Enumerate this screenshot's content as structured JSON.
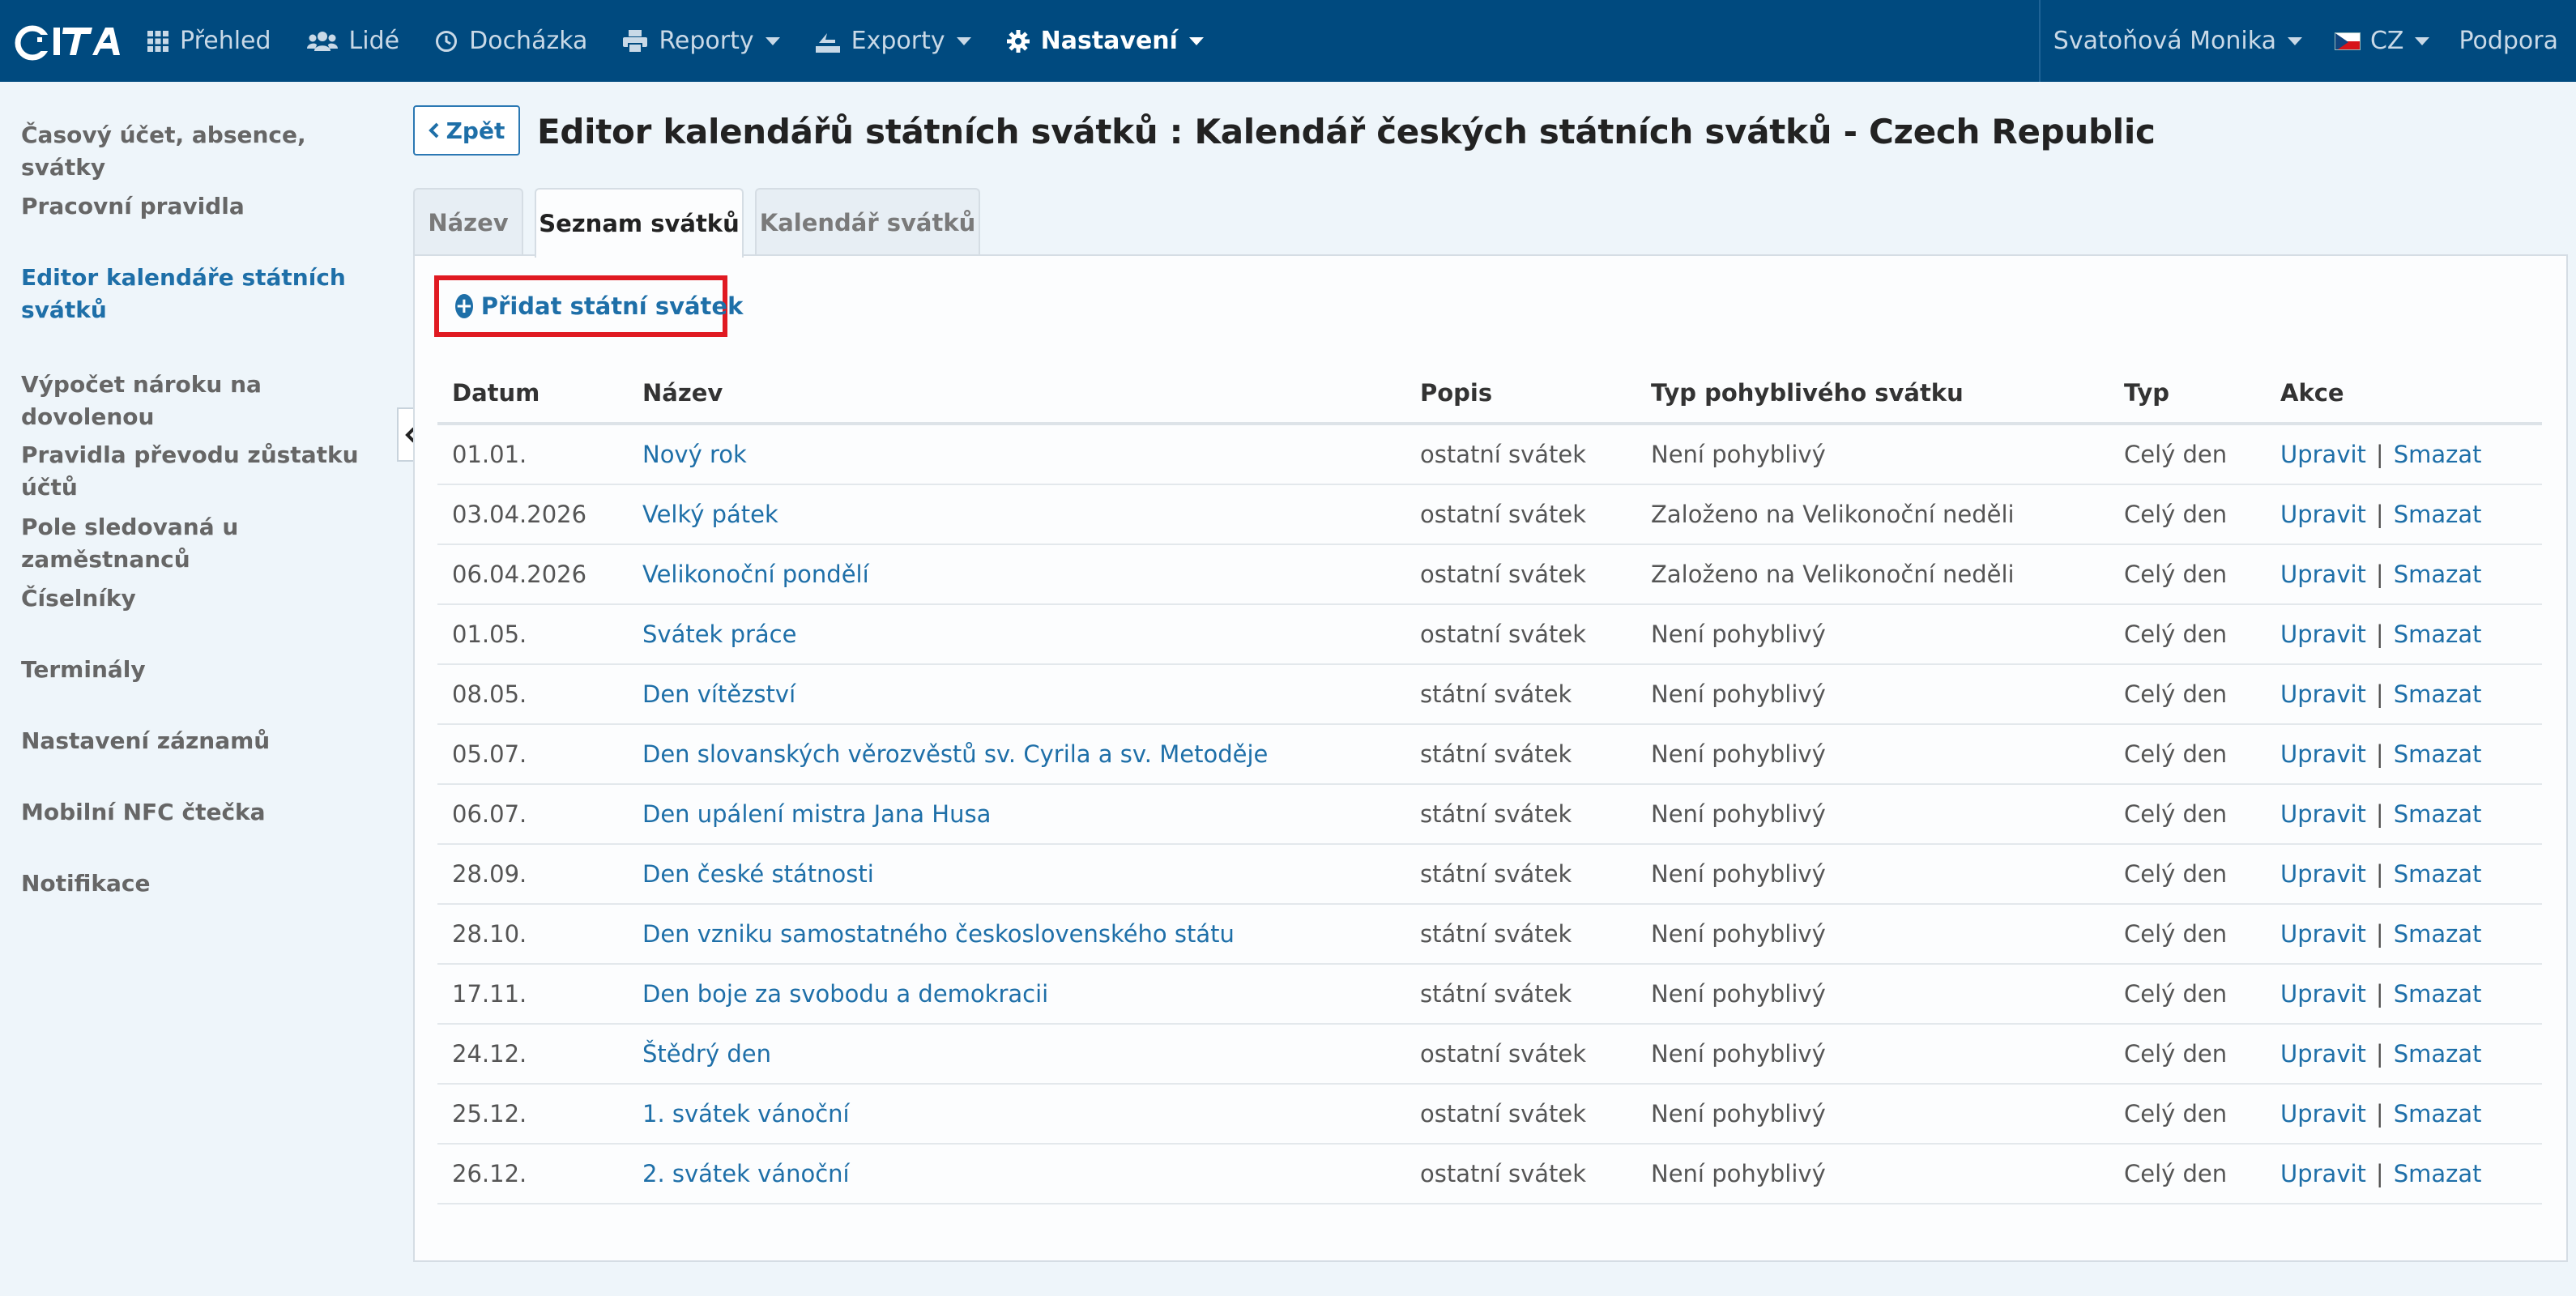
{
  "nav": {
    "logo_text": "CiTA",
    "items": [
      {
        "label": "Přehled",
        "icon": "grid-icon",
        "caret": false
      },
      {
        "label": "Lidé",
        "icon": "users-icon",
        "caret": false
      },
      {
        "label": "Docházka",
        "icon": "clock-icon",
        "caret": false
      },
      {
        "label": "Reporty",
        "icon": "printer-icon",
        "caret": true
      },
      {
        "label": "Exporty",
        "icon": "export-icon",
        "caret": true
      },
      {
        "label": "Nastavení",
        "icon": "gear-icon",
        "caret": true,
        "active": true
      }
    ],
    "user": "Svatoňová Monika",
    "language": "CZ",
    "support": "Podpora"
  },
  "sidebar": {
    "items": [
      {
        "label": "Časový účet, absence, svátky"
      },
      {
        "label": "Pracovní pravidla"
      },
      {
        "label": "Editor kalendáře státních svátků",
        "active": true
      },
      {
        "label": "Výpočet nároku na dovolenou"
      },
      {
        "label": "Pravidla převodu zůstatku účtů"
      },
      {
        "label": "Pole sledovaná u zaměstnanců"
      },
      {
        "label": "Číselníky"
      },
      {
        "label": "Terminály"
      },
      {
        "label": "Nastavení záznamů"
      },
      {
        "label": "Mobilní NFC čtečka"
      },
      {
        "label": "Notifikace"
      }
    ]
  },
  "header": {
    "back_label": "Zpět",
    "title": "Editor kalendářů státních svátků : Kalendář českých státních svátků - Czech Republic"
  },
  "tabs": [
    {
      "label": "Název"
    },
    {
      "label": "Seznam svátků",
      "active": true
    },
    {
      "label": "Kalendář svátků"
    }
  ],
  "add_button_label": "Přidat státní svátek",
  "table": {
    "columns": [
      "Datum",
      "Název",
      "Popis",
      "Typ pohyblivého svátku",
      "Typ",
      "Akce"
    ],
    "edit_label": "Upravit",
    "delete_label": "Smazat",
    "separator": "|",
    "rows": [
      {
        "date": "01.01.",
        "name": "Nový rok",
        "desc": "ostatní svátek",
        "movable": "Není pohyblivý",
        "type": "Celý den"
      },
      {
        "date": "03.04.2026",
        "name": "Velký pátek",
        "desc": "ostatní svátek",
        "movable": "Založeno na Velikonoční neděli",
        "type": "Celý den"
      },
      {
        "date": "06.04.2026",
        "name": "Velikonoční pondělí",
        "desc": "ostatní svátek",
        "movable": "Založeno na Velikonoční neděli",
        "type": "Celý den"
      },
      {
        "date": "01.05.",
        "name": "Svátek práce",
        "desc": "ostatní svátek",
        "movable": "Není pohyblivý",
        "type": "Celý den"
      },
      {
        "date": "08.05.",
        "name": "Den vítězství",
        "desc": "státní svátek",
        "movable": "Není pohyblivý",
        "type": "Celý den"
      },
      {
        "date": "05.07.",
        "name": "Den slovanských věrozvěstů sv. Cyrila a sv. Metoděje",
        "desc": "státní svátek",
        "movable": "Není pohyblivý",
        "type": "Celý den"
      },
      {
        "date": "06.07.",
        "name": "Den upálení mistra Jana Husa",
        "desc": "státní svátek",
        "movable": "Není pohyblivý",
        "type": "Celý den"
      },
      {
        "date": "28.09.",
        "name": "Den české státnosti",
        "desc": "státní svátek",
        "movable": "Není pohyblivý",
        "type": "Celý den"
      },
      {
        "date": "28.10.",
        "name": "Den vzniku samostatného československého státu",
        "desc": "státní svátek",
        "movable": "Není pohyblivý",
        "type": "Celý den"
      },
      {
        "date": "17.11.",
        "name": "Den boje za svobodu a demokracii",
        "desc": "státní svátek",
        "movable": "Není pohyblivý",
        "type": "Celý den"
      },
      {
        "date": "24.12.",
        "name": "Štědrý den",
        "desc": "ostatní svátek",
        "movable": "Není pohyblivý",
        "type": "Celý den"
      },
      {
        "date": "25.12.",
        "name": "1. svátek vánoční",
        "desc": "ostatní svátek",
        "movable": "Není pohyblivý",
        "type": "Celý den"
      },
      {
        "date": "26.12.",
        "name": "2. svátek vánoční",
        "desc": "ostatní svátek",
        "movable": "Není pohyblivý",
        "type": "Celý den"
      }
    ]
  },
  "colors": {
    "navbar": "#004a7f",
    "link": "#1e6fa8",
    "highlight_border": "#e01a22",
    "background": "#eef5fa"
  }
}
